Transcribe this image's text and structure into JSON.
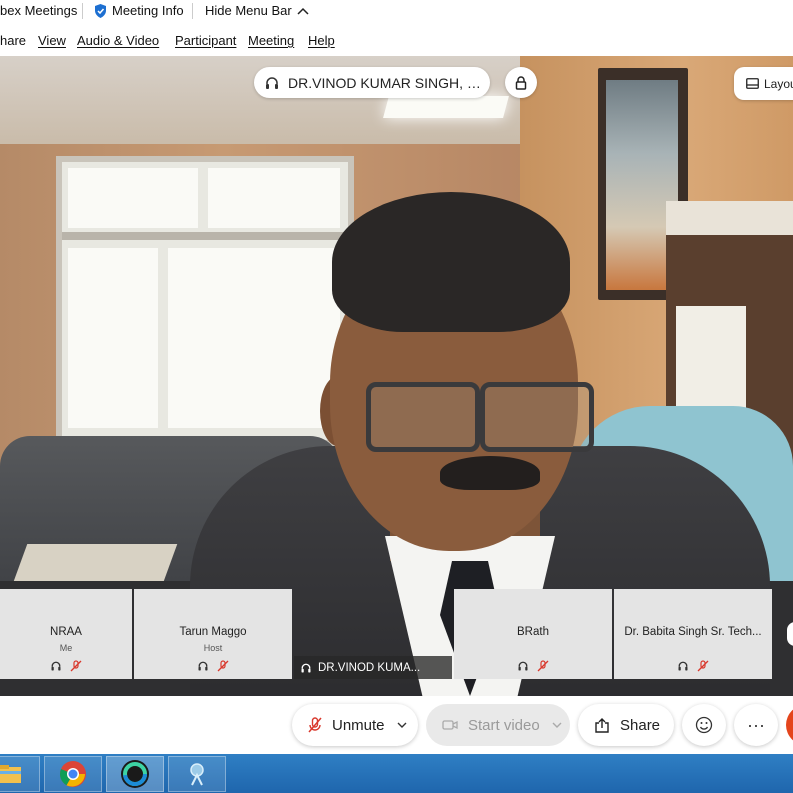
{
  "titlebar": {
    "app_name": "bex Meetings",
    "meeting_info": "Meeting Info",
    "hide_menu": "Hide Menu Bar"
  },
  "menubar": {
    "items": [
      "hare",
      "View",
      "Audio & Video",
      "Participant",
      "Meeting",
      "Help"
    ]
  },
  "speaker": {
    "name": "DR.VINOD KUMAR SINGH, DIR..."
  },
  "layout_button": {
    "label": "Layou"
  },
  "participants": [
    {
      "name": "NRAA",
      "role": "Me"
    },
    {
      "name": "Tarun Maggo",
      "role": "Host"
    },
    {
      "name": "BRath",
      "role": ""
    },
    {
      "name": "Dr. Babita Singh Sr. Tech...",
      "role": ""
    }
  ],
  "active_video_label": "DR.VINOD KUMA...",
  "controls": {
    "unmute": "Unmute",
    "start_video": "Start video",
    "share": "Share",
    "more": "···"
  },
  "colors": {
    "accent_red": "#e4451c",
    "taskbar_blue": "#1f66ad",
    "tile_gray": "#e4e4e4",
    "mute_red": "#d9382c"
  },
  "icons": {
    "meeting_info": "shield-icon",
    "hide_menu": "chevron-up-icon",
    "speaker": "headset-icon",
    "lock": "lock-icon",
    "layout": "layout-icon",
    "mic_muted": "mic-muted-icon",
    "camera": "camera-icon",
    "share": "share-icon",
    "reactions": "smiley-icon"
  }
}
